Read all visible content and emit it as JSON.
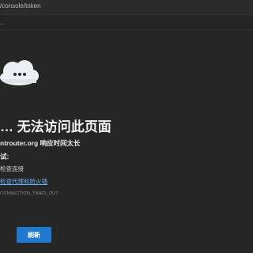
{
  "address_bar": {
    "url": "/console/token"
  },
  "toolbar": {
    "mark": "..."
  },
  "error_page": {
    "icon": "cloud-icon",
    "title": "…  无法访问此页面",
    "description_host": "ntrouter.org",
    "description_text": " 响应时间太长",
    "try_label": "试:",
    "tip_check_connection": "检查连接",
    "tip_check_proxy_link": "检查代理和防火墙",
    "error_code": "CONNECTION_TIMED_OUT",
    "refresh_label": "刷新"
  },
  "colors": {
    "background": "#262626",
    "accent_button": "#1f79d1",
    "link": "#6ab0f5"
  }
}
